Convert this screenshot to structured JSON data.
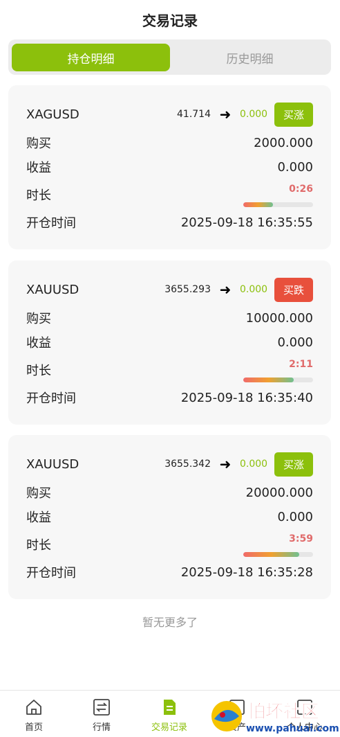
{
  "header": {
    "title": "交易记录"
  },
  "tabs": {
    "active": "持仓明细",
    "inactive": "历史明细"
  },
  "labels": {
    "buy": "购买",
    "profit": "收益",
    "duration": "时长",
    "open_time": "开仓时间"
  },
  "positions": [
    {
      "symbol": "XAGUSD",
      "open_price": "41.714",
      "current_price": "0.000",
      "direction": "买涨",
      "amount": "2000.000",
      "profit": "0.000",
      "timer": "0:26",
      "progress": 0.43,
      "open_time": "2025-09-18 16:35:55"
    },
    {
      "symbol": "XAUUSD",
      "open_price": "3655.293",
      "current_price": "0.000",
      "direction": "买跌",
      "amount": "10000.000",
      "profit": "0.000",
      "timer": "2:11",
      "progress": 0.72,
      "open_time": "2025-09-18 16:35:40"
    },
    {
      "symbol": "XAUUSD",
      "open_price": "3655.342",
      "current_price": "0.000",
      "direction": "买涨",
      "amount": "20000.000",
      "profit": "0.000",
      "timer": "3:59",
      "progress": 0.8,
      "open_time": "2025-09-18 16:35:28"
    }
  ],
  "footer": {
    "no_more": "暂无更多了"
  },
  "tabbar": [
    {
      "label": "首页",
      "icon": "home-icon"
    },
    {
      "label": "行情",
      "icon": "exchange-icon"
    },
    {
      "label": "交易记录",
      "icon": "document-icon",
      "active": true
    },
    {
      "label": "资产",
      "icon": "wallet-icon"
    },
    {
      "label": "个人中心",
      "icon": "user-icon"
    }
  ],
  "watermark": {
    "text": "怕坏社区",
    "url": "www.pahuai.com"
  },
  "colors": {
    "accent": "#8cc00c",
    "down": "#e8503c",
    "timer": "#e06b6b"
  }
}
